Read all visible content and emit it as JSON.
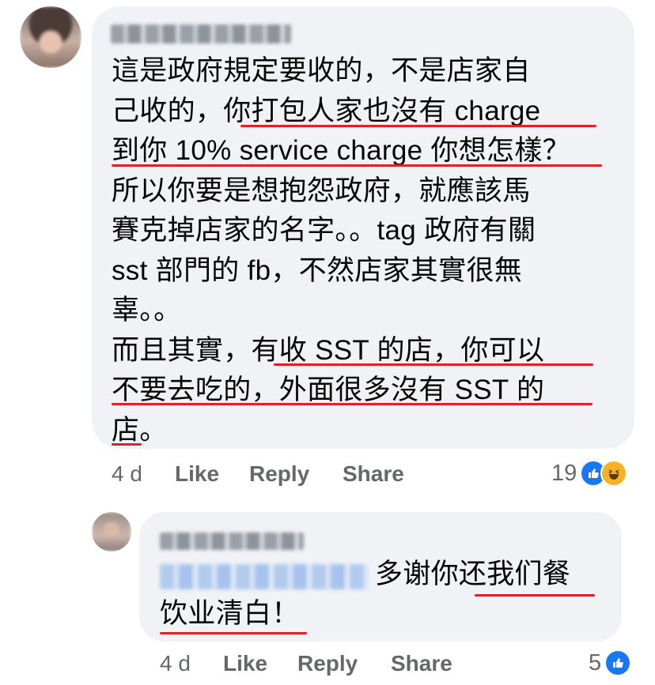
{
  "comment": {
    "lines": [
      "這是政府規定要收的，不是店家自",
      "己收的，你打包人家也沒有 charge",
      "到你 10% service charge 你想怎樣？",
      "所以你要是想抱怨政府，就應該馬",
      "賽克掉店家的名字。。tag 政府有關",
      "sst 部門的 fb，不然店家其實很無",
      "辜。。",
      "而且其實，有收 SST 的店，你可以",
      "不要去吃的，外面很多沒有 SST 的",
      "店。"
    ],
    "time": "4 d",
    "like": "Like",
    "reply": "Reply",
    "share": "Share",
    "reaction_count": "19",
    "reaction_icons": [
      "like-icon",
      "haha-icon"
    ]
  },
  "reply": {
    "text_line1": "多谢你还我们餐",
    "text_line2": "饮业清白！",
    "time": "4 d",
    "like": "Like",
    "reply": "Reply",
    "share": "Share",
    "reaction_count": "5",
    "reaction_icons": [
      "like-icon"
    ]
  },
  "colors": {
    "bubble": "#f0f2f5",
    "underline": "#e0202a",
    "meta": "#65676b",
    "like_blue": "#1877f2"
  }
}
